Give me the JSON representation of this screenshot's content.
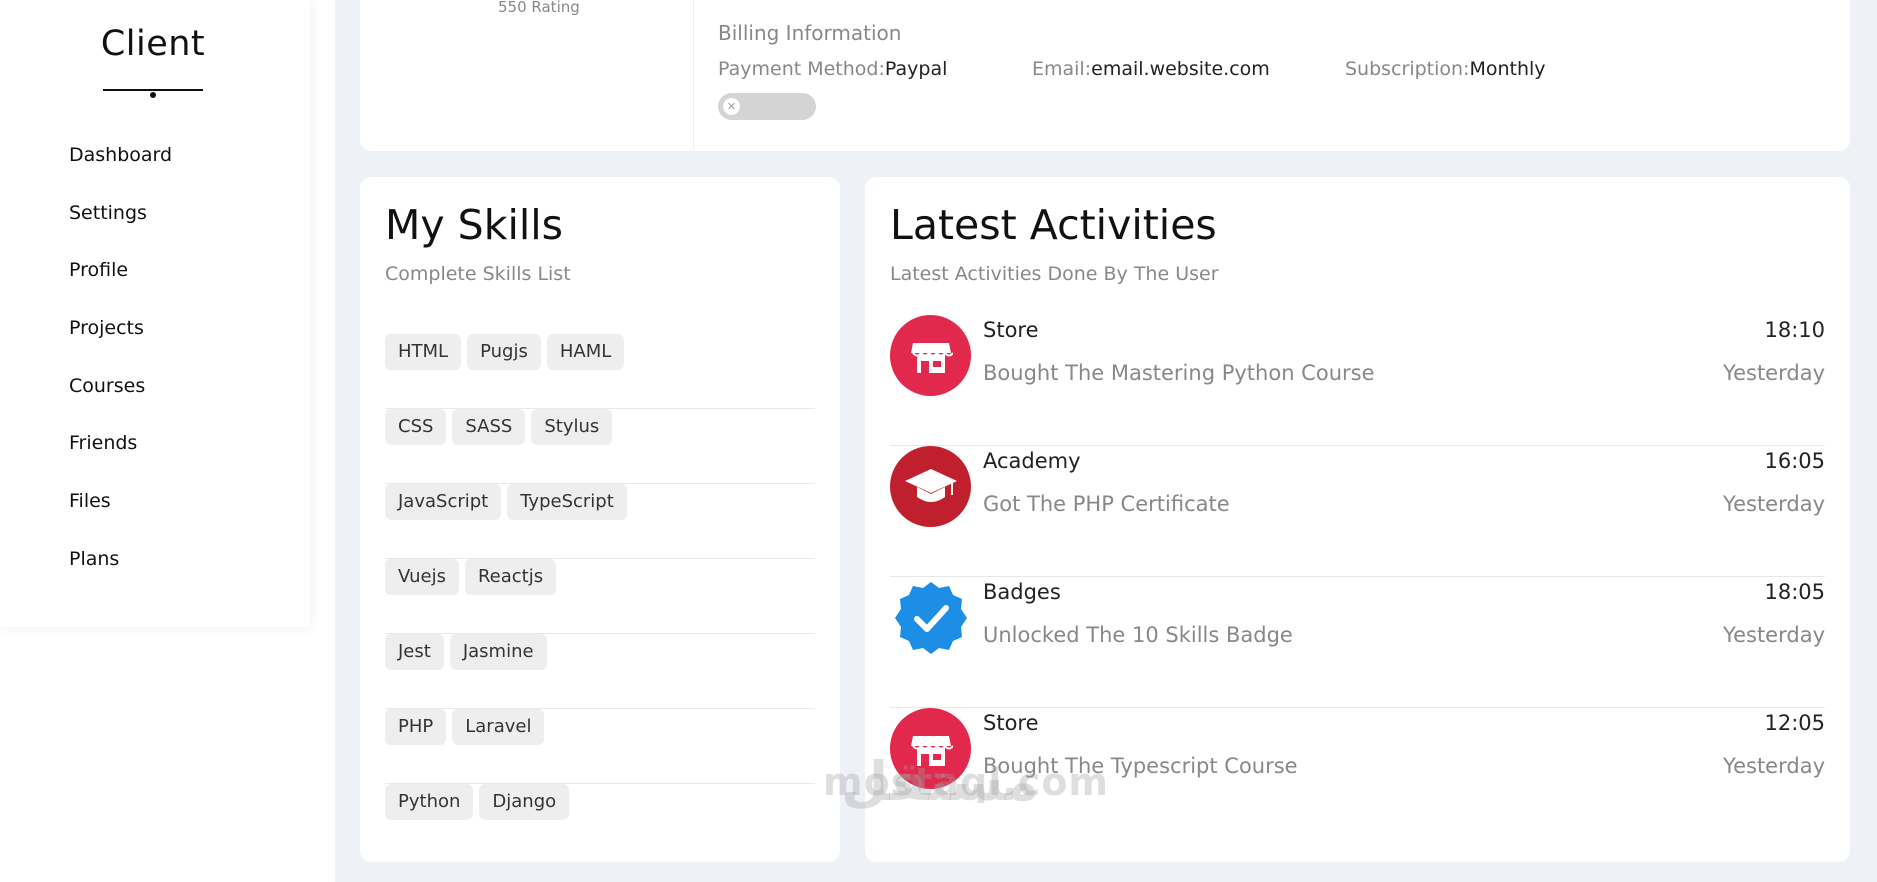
{
  "sidebar": {
    "brand": "Client",
    "items": [
      {
        "label": "Dashboard"
      },
      {
        "label": "Settings"
      },
      {
        "label": "Profile"
      },
      {
        "label": "Projects"
      },
      {
        "label": "Courses"
      },
      {
        "label": "Friends"
      },
      {
        "label": "Files"
      },
      {
        "label": "Plans"
      }
    ]
  },
  "profile": {
    "rating": "550 Rating",
    "billing_title": "Billing Information",
    "payment_label": "Payment Method:",
    "payment_value": "Paypal",
    "email_label": "Email:",
    "email_value": "email.website.com",
    "subscription_label": "Subscription:",
    "subscription_value": "Monthly",
    "toggle_icon": "close-icon"
  },
  "skills": {
    "title": "My Skills",
    "subtitle": "Complete Skills List",
    "rows": [
      [
        "HTML",
        "Pugjs",
        "HAML"
      ],
      [
        "CSS",
        "SASS",
        "Stylus"
      ],
      [
        "JavaScript",
        "TypeScript"
      ],
      [
        "Vuejs",
        "Reactjs"
      ],
      [
        "Jest",
        "Jasmine"
      ],
      [
        "PHP",
        "Laravel"
      ],
      [
        "Python",
        "Django"
      ]
    ]
  },
  "activities": {
    "title": "Latest Activities",
    "subtitle": "Latest Activities Done By The User",
    "items": [
      {
        "title": "Store",
        "desc": "Bought The Mastering Python Course",
        "time": "18:10",
        "date": "Yesterday",
        "icon": "store-icon",
        "color": "#e2284c"
      },
      {
        "title": "Academy",
        "desc": "Got The PHP Certificate",
        "time": "16:05",
        "date": "Yesterday",
        "icon": "graduation-cap-icon",
        "color": "#c0202d"
      },
      {
        "title": "Badges",
        "desc": "Unlocked The 10 Skills Badge",
        "time": "18:05",
        "date": "Yesterday",
        "icon": "verified-badge-icon",
        "color": "#1d8ee6"
      },
      {
        "title": "Store",
        "desc": "Bought The Typescript Course",
        "time": "12:05",
        "date": "Yesterday",
        "icon": "store-icon",
        "color": "#e2284c"
      }
    ]
  },
  "watermark": {
    "latin": "mostaql.com",
    "arabic": "مستقل"
  },
  "colors": {
    "main_bg": "#eef1f6",
    "card_bg": "#ffffff",
    "tag_bg": "#eeeeee",
    "muted_text": "#888888"
  }
}
